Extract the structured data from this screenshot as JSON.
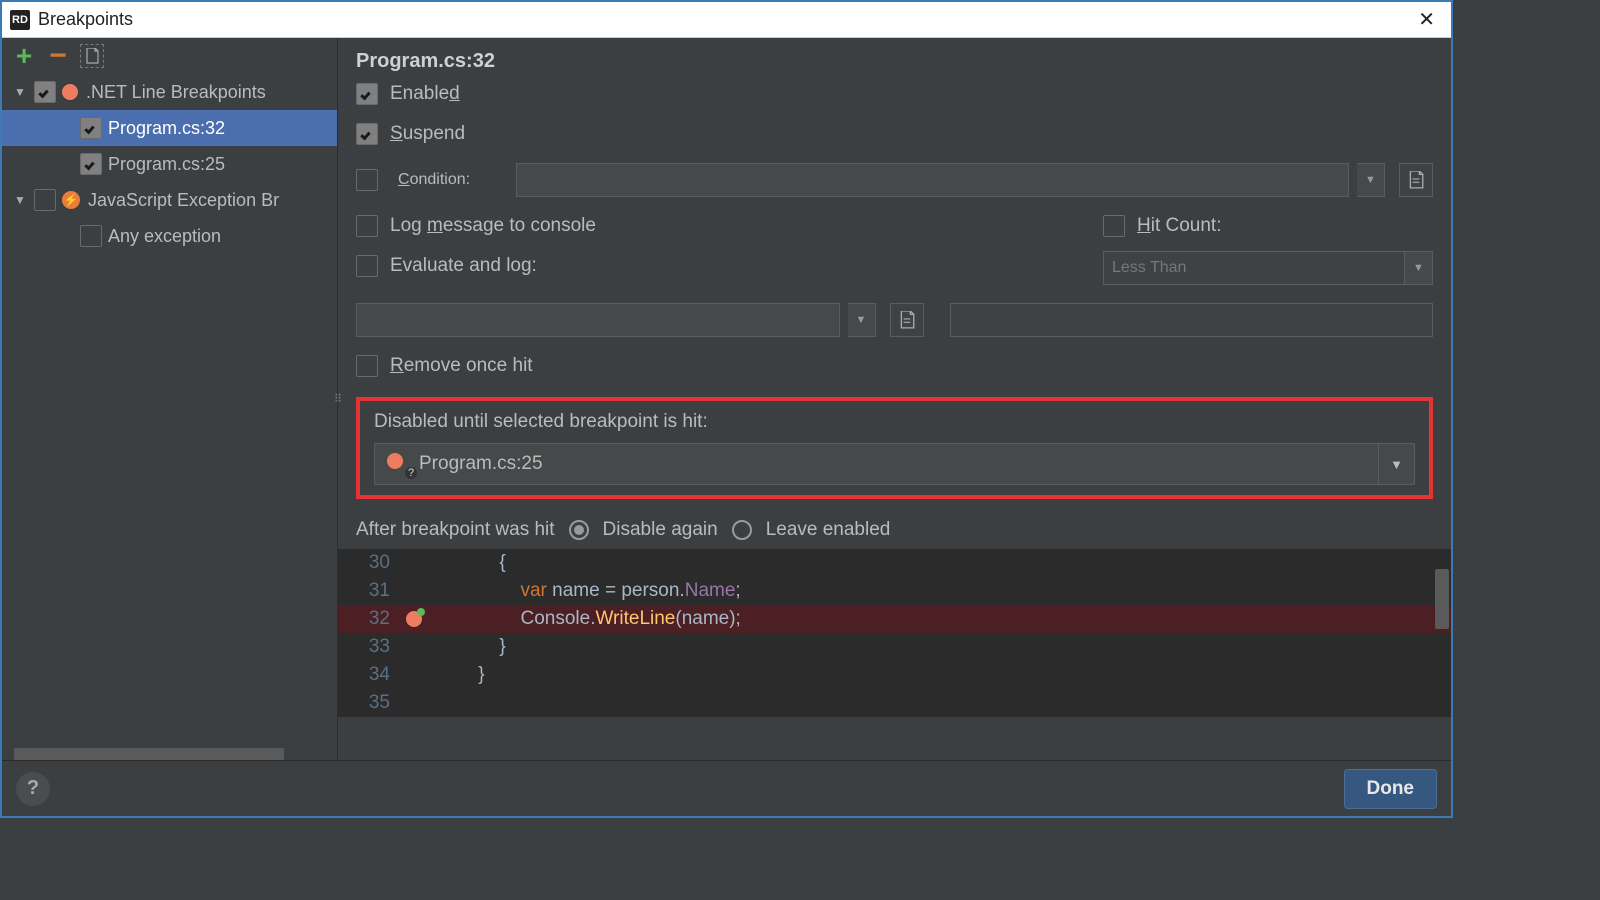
{
  "window": {
    "title": "Breakpoints"
  },
  "tree": {
    "groups": [
      {
        "label": ".NET Line Breakpoints",
        "icon": "breakpoint-dot",
        "checked": true,
        "children": [
          {
            "label": "Program.cs:32",
            "checked": true,
            "selected": true
          },
          {
            "label": "Program.cs:25",
            "checked": true,
            "selected": false
          }
        ]
      },
      {
        "label": "JavaScript Exception Br",
        "icon": "exception",
        "checked": false,
        "children": [
          {
            "label": "Any exception",
            "checked": false,
            "selected": false
          }
        ]
      }
    ]
  },
  "details": {
    "title": "Program.cs:32",
    "enabled": {
      "label": "Enabled",
      "underline_index": 6,
      "checked": true
    },
    "suspend": {
      "label": "Suspend",
      "underline_index": 0,
      "checked": true
    },
    "condition": {
      "label": "Condition:",
      "underline_index": 0,
      "checked": false,
      "value": ""
    },
    "log_message": {
      "label": "Log message to console",
      "underline_index": 4,
      "checked": false
    },
    "hit_count": {
      "label": "Hit Count:",
      "underline_index": 0,
      "checked": false,
      "operator": "Less Than",
      "value": ""
    },
    "evaluate_log": {
      "label": "Evaluate and log:",
      "checked": false,
      "value": ""
    },
    "remove_once": {
      "label": "Remove once hit",
      "underline_index": 0,
      "checked": false
    },
    "disabled_until": {
      "label": "Disabled until selected breakpoint is hit:",
      "value": "Program.cs:25"
    },
    "after_hit": {
      "label": "After breakpoint was hit",
      "options": [
        "Disable again",
        "Leave enabled"
      ],
      "selected": 0
    }
  },
  "code": {
    "lines": [
      {
        "num": 30,
        "html": "            {"
      },
      {
        "num": 31,
        "html": "                <span class='kw'>var</span> <span class='ident'>name</span> = person.<span class='prop'>Name</span>;"
      },
      {
        "num": 32,
        "html": "                <span class='cls'>Console</span>.<span class='method'>WriteLine</span>(name);",
        "breakpoint": true
      },
      {
        "num": 33,
        "html": "            }"
      },
      {
        "num": 34,
        "html": "        }"
      },
      {
        "num": 35,
        "html": ""
      }
    ]
  },
  "footer": {
    "done": "Done"
  }
}
